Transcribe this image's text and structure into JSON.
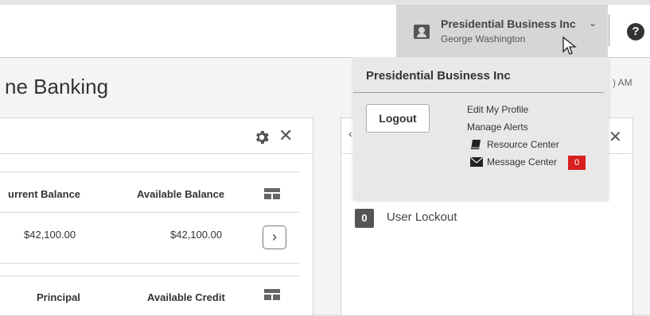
{
  "header": {
    "company_name": "Presidential Business Inc",
    "chevron": "⌄",
    "user_name": "George Washington",
    "help_glyph": "?"
  },
  "page": {
    "title_partial": "ne Banking",
    "time_partial": ") AM"
  },
  "accounts_panel": {
    "close_glyph": "✕",
    "col_current_balance": "urrent Balance",
    "col_available_balance": "Available Balance",
    "row_current_balance": "$42,100.00",
    "row_available_balance": "$42,100.00",
    "arrow_glyph": "›",
    "col_principal": "Principal",
    "col_available_credit": "Available Credit"
  },
  "alerts_panel": {
    "back_glyph": "‹",
    "close_glyph": "✕",
    "lockout_count": "0",
    "lockout_label": "User Lockout"
  },
  "dropdown": {
    "title": "Presidential Business Inc",
    "logout_label": "Logout",
    "edit_profile": "Edit My Profile",
    "manage_alerts": "Manage Alerts",
    "resource_center": "Resource Center",
    "message_center": "Message Center",
    "message_count": "0"
  },
  "colors": {
    "badge_red": "#d72020",
    "user_menu_bg": "#d6d6d6"
  },
  "icons": [
    "user-card-icon",
    "chevron-down-icon",
    "cursor-icon",
    "help-icon",
    "gear-icon",
    "close-icon",
    "grid-icon",
    "chevron-right-icon",
    "book-icon",
    "mail-icon"
  ]
}
